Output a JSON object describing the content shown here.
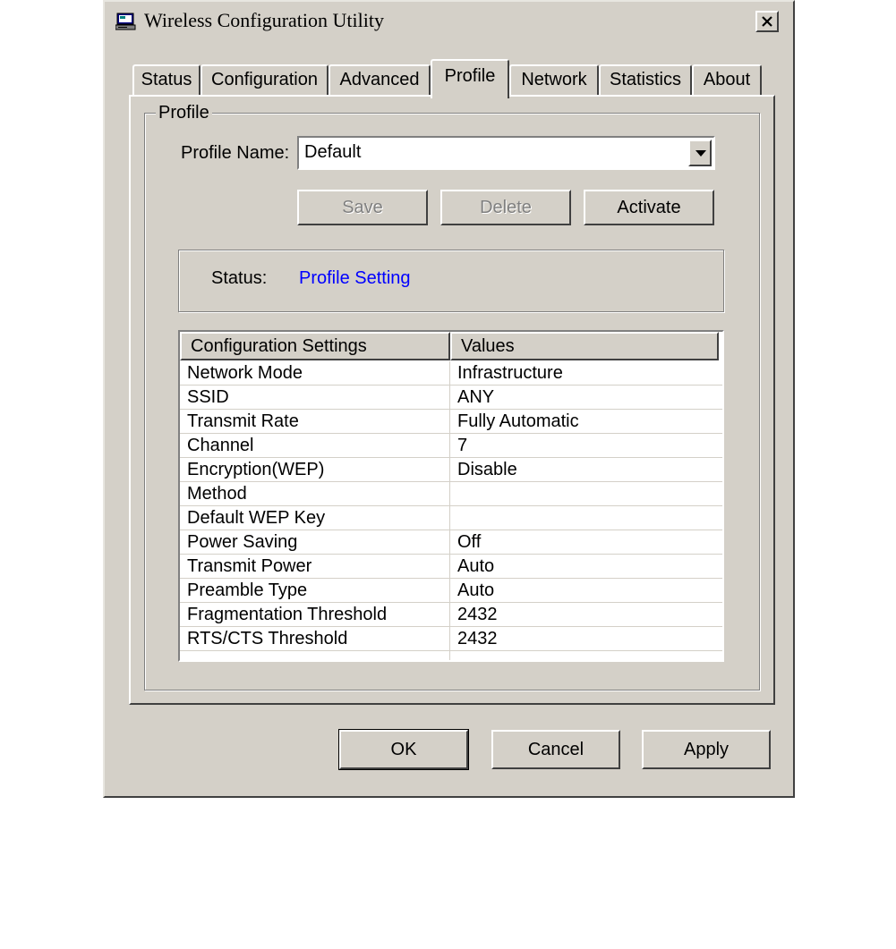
{
  "window": {
    "title": "Wireless Configuration Utility",
    "close_label": "×"
  },
  "tabs": [
    {
      "label": "Status",
      "active": false
    },
    {
      "label": "Configuration",
      "active": false
    },
    {
      "label": "Advanced",
      "active": false
    },
    {
      "label": "Profile",
      "active": true
    },
    {
      "label": "Network",
      "active": false
    },
    {
      "label": "Statistics",
      "active": false
    },
    {
      "label": "About",
      "active": false
    }
  ],
  "profile": {
    "group_label": "Profile",
    "name_label": "Profile Name:",
    "name_value": "Default",
    "buttons": {
      "save": "Save",
      "delete": "Delete",
      "activate": "Activate"
    },
    "status_label": "Status:",
    "status_value": "Profile Setting",
    "status_color": "#0000ff"
  },
  "settings_table": {
    "headers": [
      "Configuration Settings",
      "Values"
    ],
    "rows": [
      [
        "Network Mode",
        "Infrastructure"
      ],
      [
        "SSID",
        "ANY"
      ],
      [
        "Transmit Rate",
        "Fully Automatic"
      ],
      [
        "Channel",
        "7"
      ],
      [
        "Encryption(WEP)",
        "Disable"
      ],
      [
        "Method",
        ""
      ],
      [
        "Default WEP Key",
        ""
      ],
      [
        "Power Saving",
        "Off"
      ],
      [
        "Transmit Power",
        "Auto"
      ],
      [
        "Preamble Type",
        "Auto"
      ],
      [
        "Fragmentation Threshold",
        "2432"
      ],
      [
        "RTS/CTS Threshold",
        "2432"
      ]
    ]
  },
  "footer": {
    "ok": "OK",
    "cancel": "Cancel",
    "apply": "Apply"
  },
  "icons": {
    "app": "computer-icon",
    "close": "close-icon",
    "dropdown": "chevron-down-icon"
  }
}
